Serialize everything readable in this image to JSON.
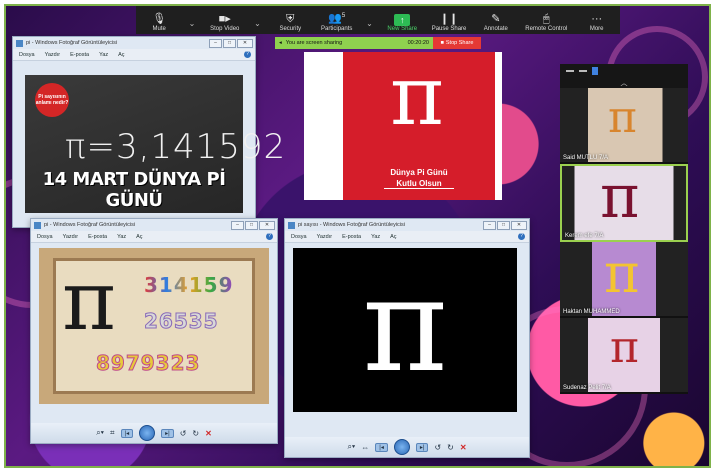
{
  "toolbar": {
    "items": [
      {
        "label": "Mute",
        "icon": "microphone-icon"
      },
      {
        "label": "Stop Video",
        "icon": "video-camera-icon"
      },
      {
        "label": "Security",
        "icon": "shield-icon"
      },
      {
        "label": "Participants",
        "icon": "participants-icon",
        "count": "5"
      },
      {
        "label": "New Share",
        "icon": "share-arrow-icon"
      },
      {
        "label": "Pause Share",
        "icon": "pause-icon"
      },
      {
        "label": "Annotate",
        "icon": "pencil-icon"
      },
      {
        "label": "Remote Control",
        "icon": "mouse-icon"
      },
      {
        "label": "More",
        "icon": "more-dots-icon"
      }
    ]
  },
  "share_banner": {
    "text": "You are screen sharing",
    "timer": "00:20:20",
    "stop_label": "Stop Share",
    "accent": "#8fd14f",
    "stop_color": "#e53935"
  },
  "window1": {
    "title": "pi - Windows Fotoğraf Görüntüleyicisi",
    "menu": [
      "Dosya",
      "Yazdır",
      "E-posta",
      "Yaz",
      "Aç"
    ],
    "badge_text": "Pi sayısının anlamı nedir?",
    "equation": "π=3,141592",
    "caption": "14 MART DÜNYA Pİ GÜNÜ"
  },
  "poster": {
    "symbol": "π",
    "line1": "Dünya Pi Günü",
    "line2": "Kutlu Olsun",
    "bg": "#d51d2a"
  },
  "window2": {
    "title": "pi - Windows Fotoğraf Görüntüleyicisi",
    "menu": [
      "Dosya",
      "Yazdır",
      "E-posta",
      "Yaz",
      "Aç"
    ],
    "symbol": "π",
    "row1": "314159",
    "row2": "26535",
    "row3": "8979323"
  },
  "window3": {
    "title": "pi sayısı - Windows Fotoğraf Görüntüleyicisi",
    "menu": [
      "Dosya",
      "Yazdır",
      "E-posta",
      "Yaz",
      "Aç"
    ],
    "symbol": "π"
  },
  "participants": [
    {
      "name": "Said MUTLU 7/A"
    },
    {
      "name": "Kerem efe 7/A"
    },
    {
      "name": "Haktan MUHAMMED"
    },
    {
      "name": "Sudenaz Pelit 7/A"
    }
  ]
}
